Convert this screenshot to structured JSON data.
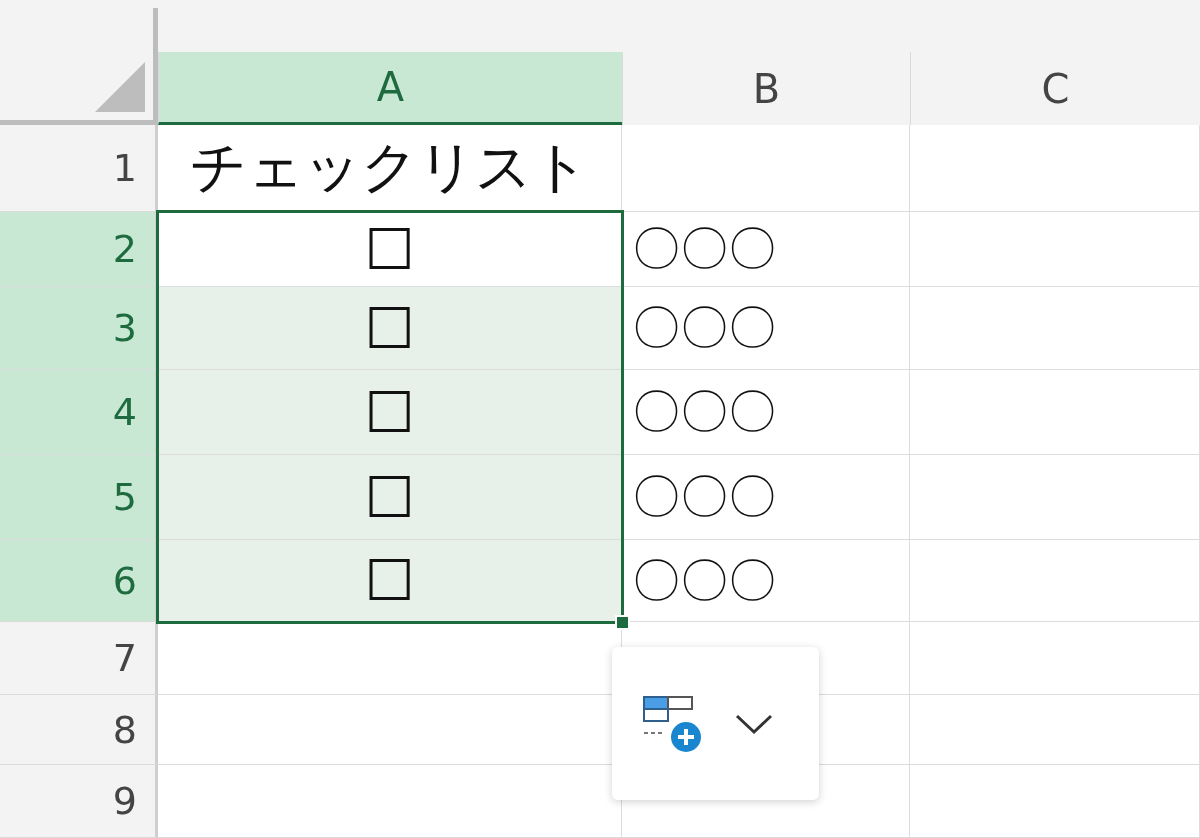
{
  "columns": [
    {
      "label": "A",
      "selected": true
    },
    {
      "label": "B",
      "selected": false
    },
    {
      "label": "C",
      "selected": false
    }
  ],
  "rows": [
    {
      "header": "1",
      "selected": false,
      "active": false,
      "cells": [
        "チェックリスト"
      ]
    },
    {
      "header": "2",
      "selected": true,
      "active": true,
      "cells": [
        "☐",
        "〇〇〇"
      ]
    },
    {
      "header": "3",
      "selected": true,
      "active": false,
      "cells": [
        "☐",
        "〇〇〇"
      ]
    },
    {
      "header": "4",
      "selected": true,
      "active": false,
      "cells": [
        "☐",
        "〇〇〇"
      ]
    },
    {
      "header": "5",
      "selected": true,
      "active": false,
      "cells": [
        "☐",
        "〇〇〇"
      ]
    },
    {
      "header": "6",
      "selected": true,
      "active": false,
      "cells": [
        "☐",
        "〇〇〇"
      ]
    },
    {
      "header": "7",
      "selected": false,
      "active": false,
      "cells": []
    },
    {
      "header": "8",
      "selected": false,
      "active": false,
      "cells": []
    },
    {
      "header": "9",
      "selected": false,
      "active": false,
      "cells": []
    }
  ]
}
